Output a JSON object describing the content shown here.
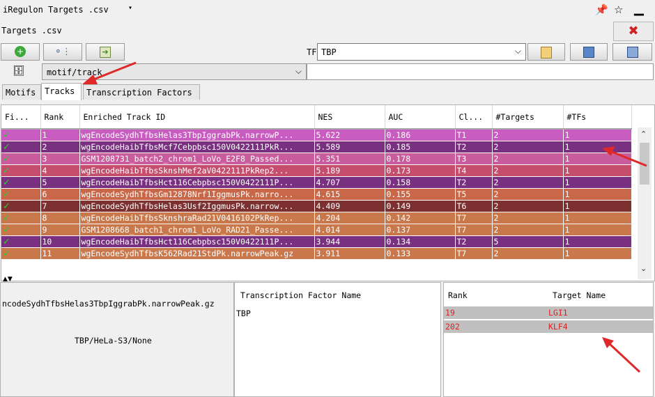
{
  "window": {
    "title": "iRegulon Targets .csv",
    "caret": "▾",
    "pin_icon": "pin-icon",
    "unpin_icon": "pin-outline-icon",
    "minimize_icon": "minimize-icon"
  },
  "file": {
    "label": "Targets .csv",
    "close_icon": "close-icon",
    "close_glyph": "✖"
  },
  "toolbar": {
    "add_glyph": "➕",
    "tree_glyph": "⚬",
    "export_glyph": "➔"
  },
  "tf": {
    "label": "TF",
    "value": "TBP",
    "chevron": "⌵"
  },
  "motif": {
    "value": "motif/track",
    "chevron": "⌵"
  },
  "tabs": [
    {
      "label": "Motifs"
    },
    {
      "label": "Tracks"
    },
    {
      "label": "Transcription Factors"
    }
  ],
  "table": {
    "headers": [
      "Fi...",
      "Rank",
      "Enriched Track ID",
      "NES",
      "AUC",
      "Cl...",
      "#Targets",
      "#TFs"
    ],
    "rows": [
      {
        "rank": "1",
        "id": "wgEncodeSydhTfbsHelas3TbpIggrabPk.narrowP...",
        "nes": "5.622",
        "auc": "0.186",
        "cl": "T1",
        "targets": "2",
        "tfs": "1",
        "color": "#c85cc0"
      },
      {
        "rank": "2",
        "id": "wgEncodeHaibTfbsMcf7Cebpbsc150V0422111PkR...",
        "nes": "5.589",
        "auc": "0.185",
        "cl": "T2",
        "targets": "2",
        "tfs": "1",
        "color": "#7a3080"
      },
      {
        "rank": "3",
        "id": "GSM1208731_batch2_chrom1_LoVo_E2F8_Passed...",
        "nes": "5.351",
        "auc": "0.178",
        "cl": "T3",
        "targets": "2",
        "tfs": "1",
        "color": "#c85c9c"
      },
      {
        "rank": "4",
        "id": "wgEncodeHaibTfbsSknshMef2aV0422111PkRep2...",
        "nes": "5.189",
        "auc": "0.173",
        "cl": "T4",
        "targets": "2",
        "tfs": "1",
        "color": "#c44e6c"
      },
      {
        "rank": "5",
        "id": "wgEncodeHaibTfbsHct116Cebpbsc150V0422111P...",
        "nes": "4.707",
        "auc": "0.158",
        "cl": "T2",
        "targets": "2",
        "tfs": "1",
        "color": "#7a3080"
      },
      {
        "rank": "6",
        "id": "wgEncodeSydhTfbsGm12878Nrf1IggmusPk.narro...",
        "nes": "4.615",
        "auc": "0.155",
        "cl": "T5",
        "targets": "2",
        "tfs": "1",
        "color": "#c86848"
      },
      {
        "rank": "7",
        "id": "wgEncodeSydhTfbsHelas3Usf2IggmusPk.narrow...",
        "nes": "4.409",
        "auc": "0.149",
        "cl": "T6",
        "targets": "2",
        "tfs": "1",
        "color": "#7c3030"
      },
      {
        "rank": "8",
        "id": "wgEncodeHaibTfbsSknshraRad21V0416102PkRep...",
        "nes": "4.204",
        "auc": "0.142",
        "cl": "T7",
        "targets": "2",
        "tfs": "1",
        "color": "#c8784a"
      },
      {
        "rank": "9",
        "id": "GSM1208668_batch1_chrom1_LoVo_RAD21_Passe...",
        "nes": "4.014",
        "auc": "0.137",
        "cl": "T7",
        "targets": "2",
        "tfs": "1",
        "color": "#c8784a"
      },
      {
        "rank": "10",
        "id": "wgEncodeHaibTfbsHct116Cebpbsc150V0422111P...",
        "nes": "3.944",
        "auc": "0.134",
        "cl": "T2",
        "targets": "5",
        "tfs": "1",
        "color": "#7a3080"
      },
      {
        "rank": "11",
        "id": "wgEncodeSydhTfbsK562Rad21StdPk.narrowPeak.gz",
        "nes": "3.911",
        "auc": "0.133",
        "cl": "T7",
        "targets": "2",
        "tfs": "1",
        "color": "#c8784a"
      }
    ]
  },
  "detail": {
    "track_id": "ncodeSydhTfbsHelas3TbpIggrabPk.narrowPeak.gz",
    "track_desc": "TBP/HeLa-S3/None",
    "tf_header": "Transcription Factor Name",
    "tf_value": "TBP"
  },
  "targets": {
    "headers": [
      "Rank",
      "Target Name"
    ],
    "rows": [
      {
        "rank": "19",
        "name": "LGI1"
      },
      {
        "rank": "202",
        "name": "KLF4"
      }
    ]
  }
}
